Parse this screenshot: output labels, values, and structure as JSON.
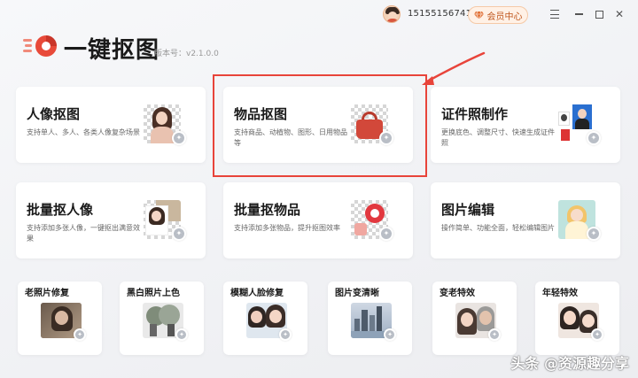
{
  "header": {
    "phone": "15155156741",
    "vip_label": "会员中心"
  },
  "app": {
    "name": "一键抠图",
    "version": "版本号：v2.1.0.0"
  },
  "cards_large": [
    {
      "title": "人像抠图",
      "desc": "支持单人、多人、各类人像复杂场景"
    },
    {
      "title": "物品抠图",
      "desc": "支持商品、动植物、图形、日用物品等"
    },
    {
      "title": "证件照制作",
      "desc": "更换底色、调整尺寸、快速生成证件照"
    },
    {
      "title": "批量抠人像",
      "desc": "支持添加多张人像，一键抠出满意效果"
    },
    {
      "title": "批量抠物品",
      "desc": "支持添加多张物品，提升抠图效率"
    },
    {
      "title": "图片编辑",
      "desc": "操作简单、功能全面，轻松编辑图片"
    }
  ],
  "cards_small": [
    {
      "title": "老照片修复"
    },
    {
      "title": "黑白照片上色"
    },
    {
      "title": "模糊人脸修复"
    },
    {
      "title": "图片变清晰"
    },
    {
      "title": "变老特效"
    },
    {
      "title": "年轻特效"
    }
  ],
  "watermark": "头条 @资源趣分享",
  "colors": {
    "highlight": "#e8443a",
    "logo_red": "#e84a3a",
    "vip_text": "#c0581f"
  },
  "icons": [
    "user-avatar-icon",
    "diamond-icon",
    "menu-icon",
    "minimize-icon",
    "maximize-icon",
    "close-icon",
    "app-logo-icon",
    "wand-icon"
  ]
}
